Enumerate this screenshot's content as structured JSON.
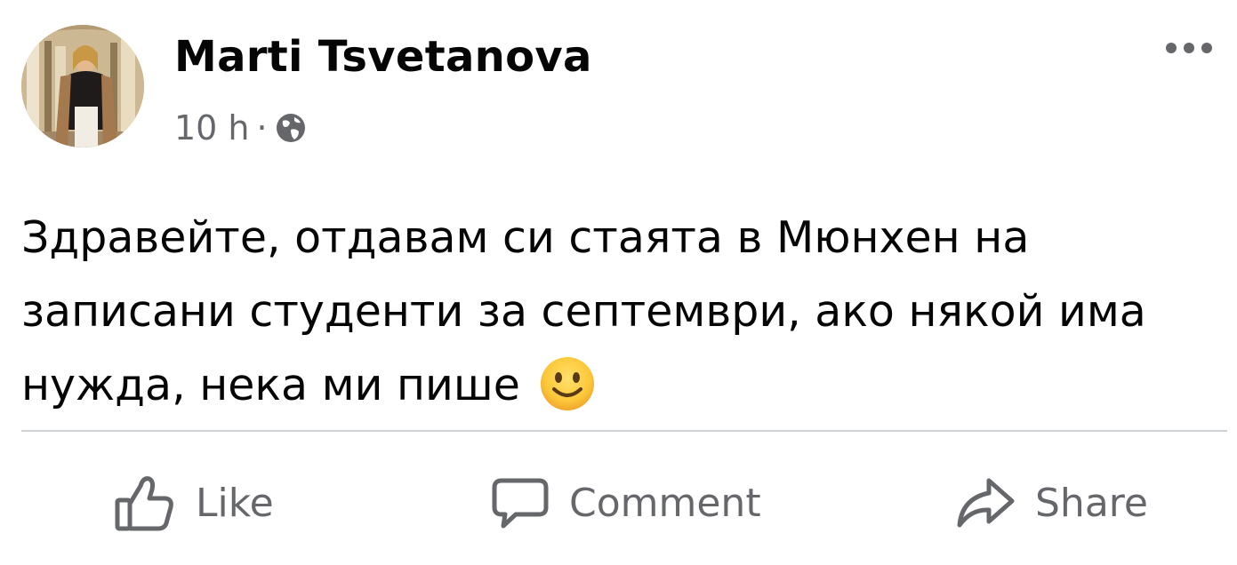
{
  "post": {
    "author": "Marti Tsvetanova",
    "time": "10 h",
    "separator": "·",
    "privacy_icon": "globe-icon",
    "more_icon": "more-options-icon",
    "text": "Здравейте, отдавам си стаята в Мюнхен на записани студенти за септември, ако някой има нужда, нека ми пише",
    "emoji": "slightly-smiling-face-emoji"
  },
  "actions": {
    "like": {
      "label": "Like",
      "icon": "thumbs-up-icon"
    },
    "comment": {
      "label": "Comment",
      "icon": "comment-bubble-icon"
    },
    "share": {
      "label": "Share",
      "icon": "share-arrow-icon"
    }
  },
  "colors": {
    "primary_text": "#050505",
    "secondary_text": "#65676b",
    "divider": "#cfd2d6",
    "background": "#ffffff"
  }
}
